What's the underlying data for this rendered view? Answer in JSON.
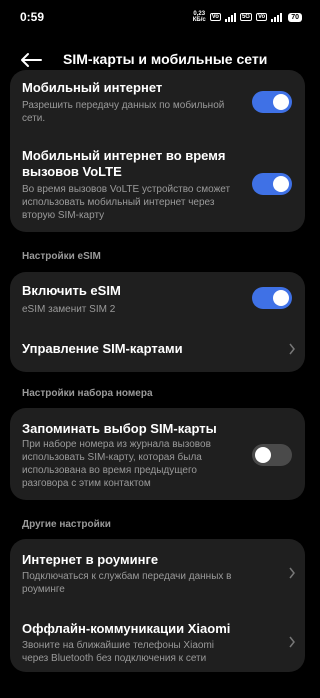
{
  "status": {
    "time": "0:59",
    "net_speed": "0,23",
    "net_unit": "КБ/с",
    "sim_badge_1": "VoLTE",
    "sim_badge_2": "5G",
    "sim_badge_3": "VoLTE",
    "battery": "70"
  },
  "header": {
    "title": "SIM-карты и мобильные сети"
  },
  "mobile_data": {
    "title": "Мобильный интернет",
    "subtitle": "Разрешить передачу данных по мобильной сети.",
    "enabled": true
  },
  "volte_data": {
    "title": "Мобильный интернет во время вызовов VoLTE",
    "subtitle": "Во время вызовов VoLTE устройство сможет использовать мобильный интернет через вторую SIM-карту",
    "enabled": true
  },
  "esim_section": {
    "label": "Настройки eSIM"
  },
  "esim_enable": {
    "title": "Включить eSIM",
    "subtitle": "eSIM заменит SIM 2",
    "enabled": true
  },
  "sim_management": {
    "title": "Управление SIM-картами"
  },
  "dial_section": {
    "label": "Настройки набора номера"
  },
  "remember_sim": {
    "title": "Запоминать выбор SIM-карты",
    "subtitle": "При наборе номера из журнала вызовов использовать SIM-карту, которая была использована во время предыдущего разговора с этим контактом",
    "enabled": false
  },
  "other_section": {
    "label": "Другие настройки"
  },
  "roaming": {
    "title": "Интернет в роуминге",
    "subtitle": "Подключаться к службам передачи данных в роуминге"
  },
  "offline_comm": {
    "title": "Оффлайн-коммуникации Xiaomi",
    "subtitle": "Звоните на ближайшие телефоны Xiaomi через Bluetooth без подключения к сети"
  },
  "colors": {
    "accent": "#3f71e6",
    "card": "#1f1f1f",
    "background": "#000000"
  }
}
